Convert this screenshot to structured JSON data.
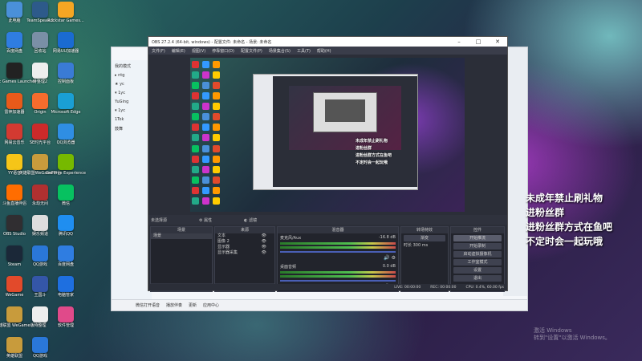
{
  "desktop_icons": [
    {
      "label": "此电脑",
      "color": "#4a90d9"
    },
    {
      "label": "TeamSpeak 3",
      "color": "#2d5a8a"
    },
    {
      "label": "Rockstar Games...",
      "color": "#f5a623"
    },
    {
      "label": "百度网盘",
      "color": "#2f7de1"
    },
    {
      "label": "回收站",
      "color": "#7a8fa6"
    },
    {
      "label": "网易UU加速器",
      "color": "#1a6bd1"
    },
    {
      "label": "Epic Games Launcher",
      "color": "#222"
    },
    {
      "label": "待整理2",
      "color": "#eee"
    },
    {
      "label": "控制面板",
      "color": "#3a7bd5"
    },
    {
      "label": "雷神加速器",
      "color": "#e85a1a"
    },
    {
      "label": "Origin",
      "color": "#f56c2d"
    },
    {
      "label": "Microsoft Edge",
      "color": "#1a9fd4"
    },
    {
      "label": "网易云音乐",
      "color": "#d33a31"
    },
    {
      "label": "SE时光平台",
      "color": "#cc2a2a"
    },
    {
      "label": "QQ浏览器",
      "color": "#2f8ee3"
    },
    {
      "label": "YY语音",
      "color": "#f5c518"
    },
    {
      "label": "英雄联盟WeGame平台",
      "color": "#c89b3c"
    },
    {
      "label": "GeForce Experience",
      "color": "#76b900"
    },
    {
      "label": "斗鱼直播伴侣",
      "color": "#ff6d00"
    },
    {
      "label": "永劫无间",
      "color": "#b03030"
    },
    {
      "label": "微信",
      "color": "#07c160"
    },
    {
      "label": "OBS Studio",
      "color": "#302e31"
    },
    {
      "label": "娱乐频道",
      "color": "#ddd"
    },
    {
      "label": "腾讯QQ",
      "color": "#1f8ef0"
    },
    {
      "label": "Steam",
      "color": "#1b2838"
    },
    {
      "label": "QQ游戏",
      "color": "#2a77d8"
    },
    {
      "label": "百度网盘",
      "color": "#2f7de1"
    },
    {
      "label": "WeGame",
      "color": "#e24a2b"
    },
    {
      "label": "王国斗",
      "color": "#3456a8"
    },
    {
      "label": "电脑管家",
      "color": "#1e6fe0"
    },
    {
      "label": "英雄联盟 WeGame版",
      "color": "#c89b3c"
    },
    {
      "label": "待整理",
      "color": "#eee"
    },
    {
      "label": "软件管理",
      "color": "#e04a8a"
    },
    {
      "label": "英雄联盟",
      "color": "#c89b3c"
    },
    {
      "label": "QQ游戏",
      "color": "#2a77d8"
    }
  ],
  "bg_window": {
    "left_items": [
      "我的模式",
      "▸ ntg",
      "★ yc",
      "▾ 1yc",
      "  YuGing",
      "▾ 1yc",
      "  1Tok",
      "  鼓舞"
    ],
    "bottom_items": [
      "微信打开语音",
      "播放伴奏",
      "更新",
      "应用中心"
    ]
  },
  "obs": {
    "title": "OBS 27.2.4 (64-bit, windows) - 配置文件: 未命名 - 场景: 未命名",
    "menu": [
      "文件(F)",
      "编辑(E)",
      "视图(V)",
      "停靠窗口(D)",
      "配置文件(P)",
      "场景集合(S)",
      "工具(T)",
      "帮助(H)"
    ],
    "source_bar": {
      "no_source": "未选择源",
      "properties": "属性",
      "filters": "滤镜"
    },
    "preview_caption": [
      "未成年禁止刷礼物",
      "进粉丝群",
      "进粉丝群方式在鱼吧",
      "不定时会一起玩哦"
    ],
    "docks": {
      "scenes": {
        "header": "场景",
        "items": [
          "场景"
        ]
      },
      "sources": {
        "header": "来源",
        "items": [
          "文本",
          "图像 2",
          "显示器",
          "显示器采集"
        ]
      },
      "mixer": {
        "header": "混音器",
        "channels": [
          {
            "name": "麦克风/Aux",
            "db": "-16.8 dB"
          },
          {
            "name": "桌面音频",
            "db": "0.0 dB"
          }
        ]
      },
      "transitions": {
        "header": "转场特效",
        "type": "渐变",
        "duration_label": "时长",
        "duration": "300 ms"
      },
      "controls": {
        "header": "控件",
        "buttons": [
          "开始推流",
          "开始录制",
          "启动虚拟摄像机",
          "工作室模式",
          "设置",
          "退出"
        ]
      }
    },
    "status": [
      "LIVE: 00:00:00",
      "REC: 00:00:00",
      "CPU: 0.4%, 60.00 fps"
    ]
  },
  "overlay_text": [
    "未成年禁止刷礼物",
    "进粉丝群",
    "进粉丝群方式在鱼吧",
    "不定时会一起玩哦"
  ],
  "activate_windows": [
    "激活 Windows",
    "转到\"设置\"以激活 Windows。"
  ]
}
